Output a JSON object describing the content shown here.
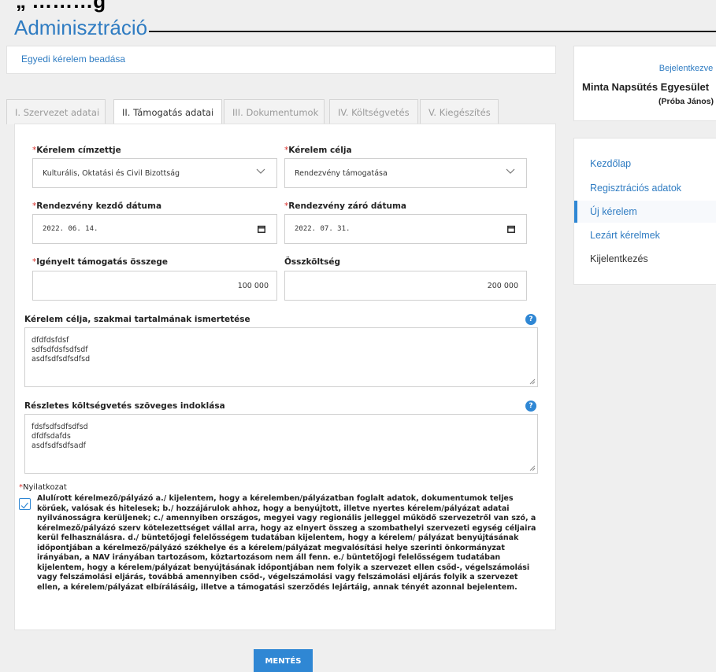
{
  "top_fragment": "„ ………g",
  "page_title": "Adminisztráció",
  "request_header": "Egyedi kérelem beadása",
  "login": {
    "label": "Bejelentkezve",
    "organization": "Minta Napsütés Egyesület",
    "user": "(Próba János)"
  },
  "tabs": [
    {
      "label": "I. Szervezet adatai"
    },
    {
      "label": "II. Támogatás adatai"
    },
    {
      "label": "III. Dokumentumok"
    },
    {
      "label": "IV. Költségvetés"
    },
    {
      "label": "V. Kiegészítés"
    }
  ],
  "active_tab": "II. Támogatás adatai",
  "form": {
    "recipient": {
      "required_mark": "*",
      "label": "Kérelem címzettje",
      "value": "Kulturális, Oktatási és Civil Bizottság"
    },
    "purpose": {
      "required_mark": "*",
      "label": "Kérelem célja",
      "value": "Rendezvény támogatása"
    },
    "start_date": {
      "required_mark": "*",
      "label": "Rendezvény kezdő dátuma",
      "value": "2022. 06. 14."
    },
    "end_date": {
      "required_mark": "*",
      "label": "Rendezvény záró dátuma",
      "value": "2022. 07. 31."
    },
    "requested_amount": {
      "required_mark": "*",
      "label": "Igényelt támogatás összege",
      "value": "100 000"
    },
    "total_cost": {
      "label": "Összköltség",
      "value": "200 000"
    },
    "description": {
      "label": "Kérelem célja, szakmai tartalmának ismertetése",
      "lines": [
        "dfdfdsfdsf",
        "sdfsdfdsfsdfsdf",
        "asdfsdfsdfsdfsd"
      ]
    },
    "budget_justification": {
      "label": "Részletes költségvetés szöveges indoklása",
      "lines": [
        "fdsfsdfsdfsdfsd",
        "dfdfsdafds",
        "asdfsdfsdfsadf"
      ]
    },
    "help_glyph": "?",
    "declaration": {
      "required_mark": "*",
      "label": "Nyilatkozat",
      "checked": true,
      "text": "Alulírott kérelmező/pályázó a./ kijelentem, hogy a kérelemben/pályázatban foglalt adatok, dokumentumok teljes körűek, valósak és hitelesek; b./ hozzájárulok ahhoz, hogy a benyújtott, illetve nyertes kérelem/pályázat adatai nyilvánosságra kerüljenek; c./ amennyiben országos, megyei vagy regionális jelleggel működő szervezetről van szó, a kérelmező/pályázó szerv kötelezettséget vállal arra, hogy az elnyert összeg a szombathelyi szervezeti egység céljaira kerül felhasználásra. d./ büntetőjogi felelősségem tudatában kijelentem, hogy a kérelem/ pályázat benyújtásának időpontjában a kérelmező/pályázó székhelye és a kérelem/pályázat megvalósítási helye szerinti önkormányzat irányában, a NAV irányában tartozásom, köztartozásom nem áll fenn. e./ büntetőjogi felelősségem tudatában kijelentem, hogy a kérelem/pályázat benyújtásának időpontjában nem folyik a szervezet ellen csőd-, végelszámolási vagy felszámolási eljárás, továbbá amennyiben csőd-, végelszámolási vagy felszámolási eljárás folyik a szervezet ellen, a kérelem/pályázat elbírálásáig, illetve a támogatási szerződés lejártáig, annak tényét azonnal bejelentem."
    },
    "save_label": "MENTÉS"
  },
  "sidenav": [
    {
      "label": "Kezdőlap",
      "state": "link"
    },
    {
      "label": "Regisztrációs adatok",
      "state": "link"
    },
    {
      "label": "Új kérelem",
      "state": "active"
    },
    {
      "label": "Lezárt kérelmek",
      "state": "link"
    },
    {
      "label": "Kijelentkezés",
      "state": "plain"
    }
  ],
  "colors": {
    "accent": "#2f87d4",
    "link": "#2f7cc2",
    "required": "#d9302c",
    "background": "#efefef"
  }
}
